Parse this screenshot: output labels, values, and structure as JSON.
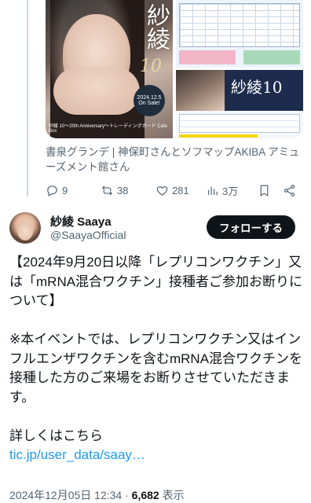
{
  "previous_post": {
    "media": {
      "left_image": {
        "title_kanji": "紗綾",
        "number_mark": "10",
        "sale_badge": "2024.12.5 On Sale!",
        "caption": "紗綾 10～20th Anniversary～トレーディングカード Cafe Box"
      },
      "right_image": {
        "flyer_title": "紗綾10"
      }
    },
    "caption": "書泉グランデ | 神保町さんとソフマップAKIBA アミューズメント館さん",
    "actions": {
      "replies": "9",
      "reposts": "38",
      "likes": "281",
      "views": "3万"
    }
  },
  "post": {
    "author": {
      "display_name": "紗綾 Saaya",
      "handle": "@SaayaOfficial"
    },
    "follow_label": "フォローする",
    "paragraphs": [
      "【2024年9月20日以降「レプリコンワクチン」又は「mRNA混合ワクチン」接種者ご参加お断りについて】",
      "※本イベントでは、レプリコンワクチン又はインフルエンザワクチンを含むmRNA混合ワクチンを接種した方のご来場をお断りさせていただきます。"
    ],
    "details_label": "詳しくはこちら",
    "link_text": "tic.jp/user_data/saay…",
    "timestamp": "2024年12月05日 12:34",
    "separator": "·",
    "view_count": "6,682",
    "view_suffix": "表示"
  },
  "colors": {
    "text": "#0f1419",
    "secondary": "#536471",
    "link": "#1d9bf0",
    "button_bg": "#0f1419",
    "thread_line": "#cfd9de"
  },
  "icons": [
    "reply-icon",
    "repost-icon",
    "like-icon",
    "views-icon",
    "bookmark-icon",
    "share-icon"
  ]
}
